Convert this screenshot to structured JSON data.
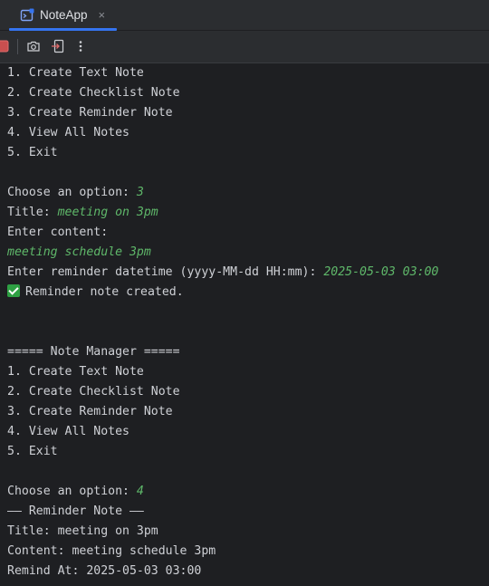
{
  "tab": {
    "title": "NoteApp",
    "icon": "run-console-icon",
    "close": "×"
  },
  "toolbar": {
    "icons": [
      "stop-icon",
      "camera-icon",
      "exit-icon",
      "more-icon"
    ],
    "stop_color": "#c94f4f"
  },
  "colors": {
    "background": "#1e1f22",
    "text": "#cfd1d6",
    "user_input": "#5fb86a",
    "accent": "#3574f0",
    "success": "#2ea043"
  },
  "console": {
    "line0": "1. Create Text Note",
    "line1": "2. Create Checklist Note",
    "line2": "3. Create Reminder Note",
    "line3": "4. View All Notes",
    "line4": "5. Exit",
    "line6_prompt": "Choose an option: ",
    "line6_input": "3",
    "line7_prompt": "Title: ",
    "line7_input": "meeting on 3pm",
    "line8": "Enter content:",
    "line9_input": "meeting schedule 3pm",
    "line10_prompt": "Enter reminder datetime (yyyy-MM-dd HH:mm): ",
    "line10_input": "2025-05-03 03:00",
    "line11": "Reminder note created.",
    "line14": "===== Note Manager =====",
    "line15": "1. Create Text Note",
    "line16": "2. Create Checklist Note",
    "line17": "3. Create Reminder Note",
    "line18": "4. View All Notes",
    "line19": "5. Exit",
    "line21_prompt": "Choose an option: ",
    "line21_input": "4",
    "line22": "—— Reminder Note ——",
    "line23": "Title: meeting on 3pm",
    "line24": "Content: meeting schedule 3pm",
    "line25": "Remind At: 2025-05-03 03:00"
  }
}
